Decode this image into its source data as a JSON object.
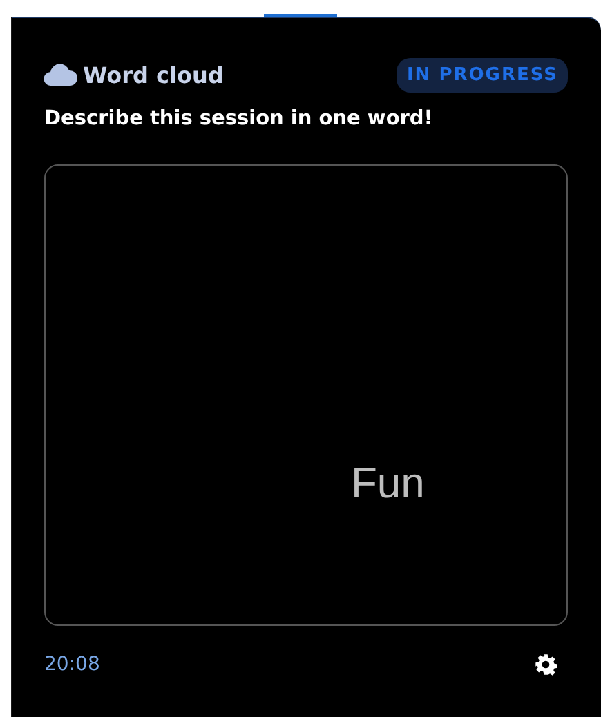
{
  "card": {
    "title": "Word cloud",
    "status": "IN PROGRESS",
    "question": "Describe this session in one word!",
    "words": [
      {
        "text": "Fun"
      }
    ],
    "time": "20:08"
  }
}
